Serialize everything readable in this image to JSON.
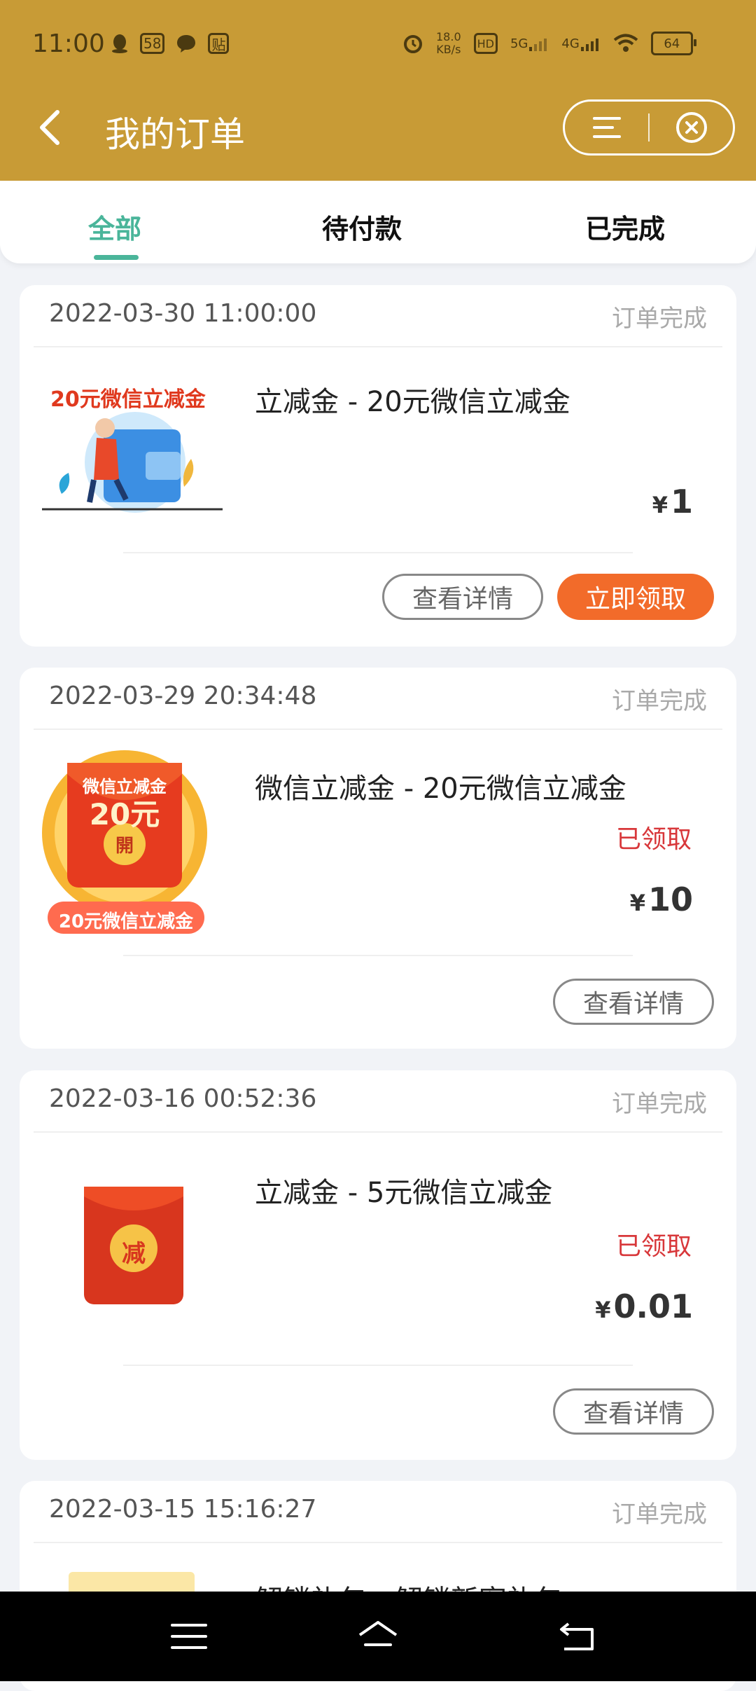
{
  "status_bar": {
    "time": "11:00",
    "badge_58": "58",
    "badge_tie": "贴",
    "net_speed_value": "18.0",
    "net_speed_unit": "KB/s",
    "hd": "HD",
    "sim1": "5G",
    "sim2": "4G",
    "battery": "64"
  },
  "header": {
    "title": "我的订单"
  },
  "tabs": [
    {
      "label": "全部",
      "active": true
    },
    {
      "label": "待付款",
      "active": false
    },
    {
      "label": "已完成",
      "active": false
    }
  ],
  "orders": [
    {
      "time": "2022-03-30 11:00:00",
      "status": "订单完成",
      "name": "立减金 - 20元微信立减金",
      "thumb_text": "20元微信立减金",
      "price_symbol": "¥",
      "price": "1",
      "detail_label": "查看详情",
      "claim_label": "立即领取"
    },
    {
      "time": "2022-03-29 20:34:48",
      "status": "订单完成",
      "name": "微信立减金 - 20元微信立减金",
      "thumb_top": "微信立减金",
      "thumb_amount": "20元",
      "thumb_open": "開",
      "thumb_bottom": "20元微信立减金",
      "claimed": "已领取",
      "price_symbol": "¥",
      "price": "10",
      "detail_label": "查看详情"
    },
    {
      "time": "2022-03-16 00:52:36",
      "status": "订单完成",
      "name": "立减金 - 5元微信立减金",
      "thumb_char": "减",
      "claimed": "已领取",
      "price_symbol": "¥",
      "price": "0.01",
      "detail_label": "查看详情"
    },
    {
      "time": "2022-03-15 15:16:27",
      "status": "订单完成",
      "name": "解锁礼包 - 解锁新客礼包"
    }
  ],
  "colors": {
    "header_bg": "#c89b36",
    "tab_active": "#4ab59a",
    "claim_button": "#f26b2a",
    "claimed_text": "#d8373a"
  }
}
